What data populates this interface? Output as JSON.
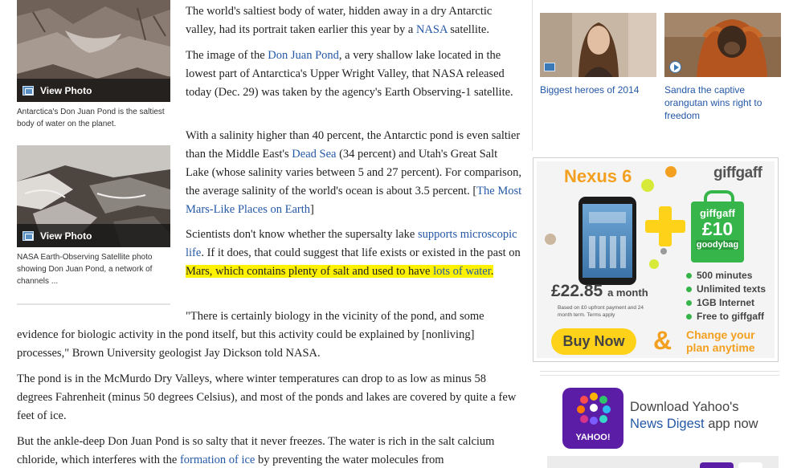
{
  "left_photos": [
    {
      "view_label": "View Photo",
      "caption": "Antarctica's Don Juan Pond is the saltiest body of water on the planet.",
      "icon": "photo-icon"
    },
    {
      "view_label": "View Photo",
      "caption": "NASA Earth-Observing Satellite photo showing Don Juan Pond, a network of channels ...",
      "icon": "photo-icon"
    }
  ],
  "article": {
    "p1": {
      "t1": "The world's saltiest body of water, hidden away in a dry Antarctic valley, had its portrait taken earlier this year by a ",
      "link": "NASA",
      "t2": " satellite."
    },
    "p2": {
      "t1": "The image of the ",
      "link": "Don Juan Pond",
      "t2": ", a very shallow lake located in the lowest part of Antarctica's Upper Wright Valley, that NASA released today (Dec. 29) was taken by the agency's Earth Observing-1 satellite."
    },
    "p3": {
      "t1": "With a salinity higher than 40 percent, the Antarctic pond is even saltier than the Middle East's ",
      "link1": "Dead Sea",
      "t2": " (34 percent) and Utah's Great Salt Lake (whose salinity varies between 5 and 27 percent). For comparison, the average salinity of the world's ocean is about 3.5 percent. [",
      "link2": "The Most Mars-Like Places on Earth",
      "t3": "]"
    },
    "p4": {
      "t1": "Scientists don't know whether the supersalty lake ",
      "link1": "supports microscopic life",
      "t2": ". If it does, that could suggest that life exists or existed in the past on ",
      "hl1": "Mars, which contains plenty of salt and used to have ",
      "link2": "lots of water",
      "hl2": "."
    },
    "p5": "\"There is certainly biology in the vicinity of the pond, and some evidence for biologic activity in the pond itself, but this activity could be explained by [nonliving] processes,\" Brown University geologist Jay Dickson told NASA.",
    "p6": "The pond is in the McMurdo Dry Valleys, where winter temperatures can drop to as low as minus 58 degrees Fahrenheit (minus 50 degrees Celsius), and most of the ponds and lakes are covered by quite a few feet of ice.",
    "p7": {
      "t1": "But the ankle-deep Don Juan Pond is so salty that it never freezes. The water is rich in the salt calcium chloride, which interferes with the ",
      "link": "formation of ice",
      "t2": " by preventing the water molecules from"
    }
  },
  "right_tiles": [
    {
      "caption": "Biggest heroes of 2014",
      "badge": "photo-icon"
    },
    {
      "caption": "Sandra the captive orangutan wins right to freedom",
      "badge": "play-icon"
    }
  ],
  "ad": {
    "title": "Nexus 6",
    "brand": "giffgaff",
    "bag_brand": "giffgaff",
    "bag_amount": "£10",
    "bag_label": "goodybag",
    "price": "£22.85",
    "price_suffix": "a month",
    "fine_print": "Based on £0 upfront payment and 24 month term. Terms apply",
    "features": [
      "500 minutes",
      "Unlimited texts",
      "1GB Internet",
      "Free to giffgaff"
    ],
    "buy_label": "Buy Now",
    "ampersand": "&",
    "change_line1": "Change your",
    "change_line2": "plan anytime",
    "colors": {
      "orange": "#f3a020",
      "green": "#35b54a",
      "yellow": "#ffd21a"
    }
  },
  "yahoo_promo": {
    "logo_text": "YAHOO!",
    "line1": "Download Yahoo's",
    "line2_blue": "News Digest",
    "line2_rest": " app now"
  },
  "colors": {
    "link": "#2458a6",
    "highlight": "#fff200",
    "yahoo_purple": "#5c1da6"
  }
}
